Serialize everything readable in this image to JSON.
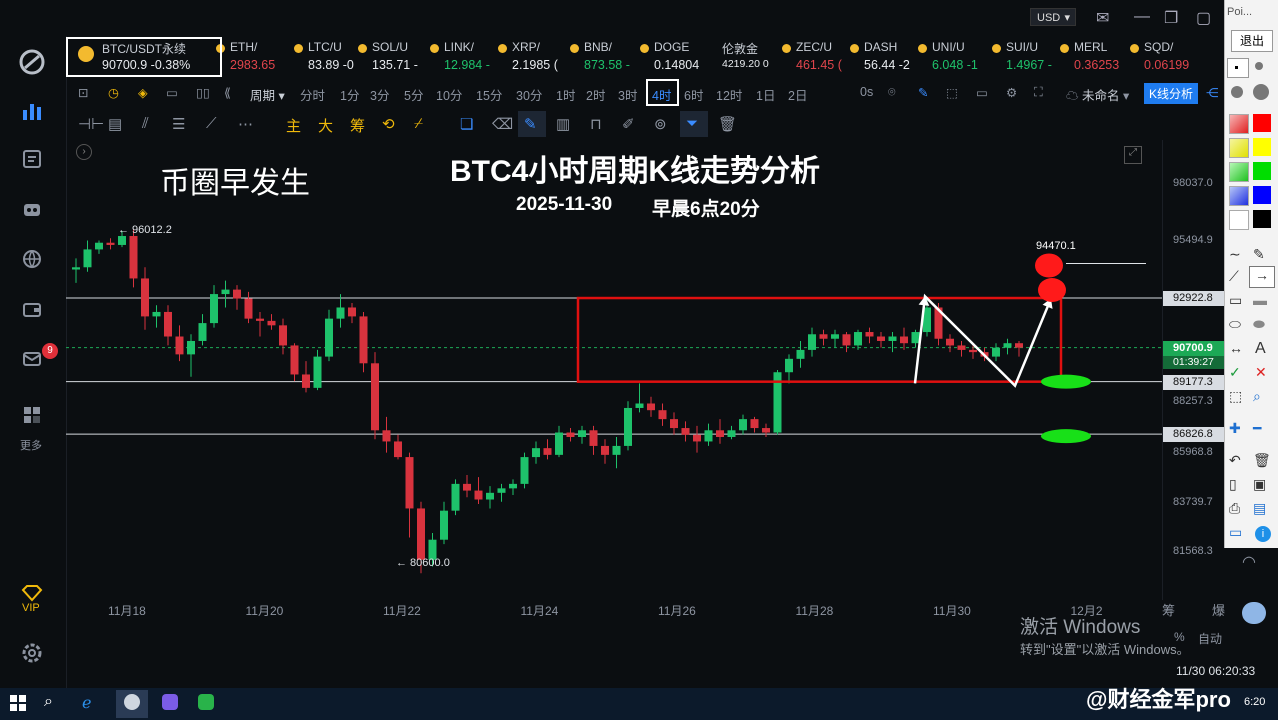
{
  "window": {
    "currency_select": "USD",
    "currency_arrow": "▾"
  },
  "sidebar": {
    "items": [
      {
        "icon": "logo-icon"
      },
      {
        "icon": "bar-chart-icon"
      },
      {
        "icon": "news-icon"
      },
      {
        "icon": "robot-icon"
      },
      {
        "icon": "globe-icon"
      },
      {
        "icon": "wallet-icon"
      },
      {
        "icon": "message-icon"
      },
      {
        "icon": "grid-icon",
        "label": "更多"
      }
    ],
    "message_badge": "9",
    "vip_label": "VIP"
  },
  "tickers": [
    {
      "name": "BTC/USDT永续",
      "price": "90700.9",
      "change": "-0.38%",
      "color": "#e8ebef"
    },
    {
      "name": "ETH/",
      "price": "2983.65",
      "change": "",
      "color": "#e0454c"
    },
    {
      "name": "LTC/U",
      "price": "83.89",
      "change": "-0",
      "color": "#e8ebef"
    },
    {
      "name": "SOL/U",
      "price": "135.71",
      "change": "-",
      "color": "#e8ebef"
    },
    {
      "name": "LINK/",
      "price": "12.984",
      "change": "-",
      "color": "#1ec26b"
    },
    {
      "name": "XRP/",
      "price": "2.1985",
      "change": "(",
      "color": "#e8ebef"
    },
    {
      "name": "BNB/",
      "price": "873.58",
      "change": "-",
      "color": "#1ec26b"
    },
    {
      "name": "DOGE",
      "price": "0.14804",
      "change": "",
      "color": "#e8ebef"
    },
    {
      "name": "伦敦金",
      "price": "4219.20",
      "change": "0",
      "color": "#e8ebef"
    },
    {
      "name": "ZEC/U",
      "price": "461.45",
      "change": "(",
      "color": "#e0454c"
    },
    {
      "name": "DASH",
      "price": "56.44",
      "change": "-2",
      "color": "#e8ebef"
    },
    {
      "name": "UNI/U",
      "price": "6.048",
      "change": "-1",
      "color": "#1ec26b"
    },
    {
      "name": "SUI/U",
      "price": "1.4967",
      "change": "-",
      "color": "#1ec26b"
    },
    {
      "name": "MERL",
      "price": "0.36253",
      "change": "",
      "color": "#e0454c"
    },
    {
      "name": "SQD/",
      "price": "0.06199",
      "change": "",
      "color": "#e0454c"
    }
  ],
  "periods": {
    "cycle_label": "周期",
    "items": [
      "分时",
      "1分",
      "3分",
      "5分",
      "10分",
      "15分",
      "30分",
      "1时",
      "2时",
      "3时",
      "4时",
      "6时",
      "12时",
      "1日",
      "2日"
    ],
    "active": "4时",
    "zero_s": "0s",
    "layout_name": "未命名",
    "kline_analysis": "K线分析"
  },
  "drawbar": {
    "main_label": "主",
    "big_label": "大",
    "chip_label": "筹"
  },
  "chart": {
    "overlay_title": "BTC4小时周期K线走势分析",
    "overlay_date": "2025-11-30",
    "overlay_time": "早晨6点20分",
    "overlay_brand": "币圈早发生",
    "high_note": "← 96012.2",
    "low_note": "← 80600.0",
    "target_note": "94470.1",
    "windows_watermark_1": "激活 Windows",
    "windows_watermark_2": "转到\"设置\"以激活 Windows。",
    "scale_chip": "筹",
    "scale_burst": "爆",
    "pct_label": "%",
    "auto_label": "自动",
    "clock": "11/30 06:20:33"
  },
  "chart_data": {
    "type": "candlestick",
    "title": "BTC4小时周期K线走势分析",
    "symbol": "BTC/USDT永续",
    "interval": "4h",
    "current_price": 90700.9,
    "countdown": "01:39:27",
    "price_ticks": [
      98037.0,
      95494.9,
      88257.3,
      85968.8,
      83739.7,
      81568.3
    ],
    "horizontal_lines": [
      92922.8,
      89177.3,
      86826.8
    ],
    "x_ticks": [
      "11月18",
      "11月20",
      "11月22",
      "11月24",
      "11月26",
      "11月28",
      "11月30",
      "12月2"
    ],
    "ylim": [
      79400,
      100000
    ],
    "high": 96012.2,
    "low": 80600.0,
    "candles": [
      {
        "o": 94200,
        "h": 94700,
        "l": 93600,
        "c": 94300
      },
      {
        "o": 94300,
        "h": 95500,
        "l": 94100,
        "c": 95100
      },
      {
        "o": 95100,
        "h": 95500,
        "l": 94900,
        "c": 95400
      },
      {
        "o": 95400,
        "h": 95600,
        "l": 95100,
        "c": 95300
      },
      {
        "o": 95300,
        "h": 95900,
        "l": 95200,
        "c": 95700
      },
      {
        "o": 95700,
        "h": 96012.2,
        "l": 93400,
        "c": 93800
      },
      {
        "o": 93800,
        "h": 94300,
        "l": 91500,
        "c": 92100
      },
      {
        "o": 92100,
        "h": 92600,
        "l": 91600,
        "c": 92300
      },
      {
        "o": 92300,
        "h": 92600,
        "l": 90800,
        "c": 91200
      },
      {
        "o": 91200,
        "h": 91700,
        "l": 90100,
        "c": 90400
      },
      {
        "o": 90400,
        "h": 91300,
        "l": 89400,
        "c": 91000
      },
      {
        "o": 91000,
        "h": 92200,
        "l": 90800,
        "c": 91800
      },
      {
        "o": 91800,
        "h": 93500,
        "l": 91600,
        "c": 93100
      },
      {
        "o": 93100,
        "h": 93700,
        "l": 92500,
        "c": 93300
      },
      {
        "o": 93300,
        "h": 93500,
        "l": 92400,
        "c": 92900
      },
      {
        "o": 92900,
        "h": 93200,
        "l": 91800,
        "c": 92000
      },
      {
        "o": 92000,
        "h": 92300,
        "l": 91200,
        "c": 91900
      },
      {
        "o": 91900,
        "h": 92200,
        "l": 91500,
        "c": 91700
      },
      {
        "o": 91700,
        "h": 92000,
        "l": 90400,
        "c": 90800
      },
      {
        "o": 90800,
        "h": 90900,
        "l": 89200,
        "c": 89500
      },
      {
        "o": 89500,
        "h": 90100,
        "l": 88700,
        "c": 88900
      },
      {
        "o": 88900,
        "h": 90600,
        "l": 88800,
        "c": 90300
      },
      {
        "o": 90300,
        "h": 92400,
        "l": 90100,
        "c": 92000
      },
      {
        "o": 92000,
        "h": 93100,
        "l": 91600,
        "c": 92500
      },
      {
        "o": 92500,
        "h": 92700,
        "l": 91800,
        "c": 92100
      },
      {
        "o": 92100,
        "h": 92300,
        "l": 89600,
        "c": 90000
      },
      {
        "o": 90000,
        "h": 90500,
        "l": 86600,
        "c": 87000
      },
      {
        "o": 87000,
        "h": 87600,
        "l": 86000,
        "c": 86500
      },
      {
        "o": 86500,
        "h": 86800,
        "l": 85700,
        "c": 85800
      },
      {
        "o": 85800,
        "h": 86000,
        "l": 82200,
        "c": 83500
      },
      {
        "o": 83500,
        "h": 83800,
        "l": 80600,
        "c": 81200
      },
      {
        "o": 81200,
        "h": 82400,
        "l": 80900,
        "c": 82100
      },
      {
        "o": 82100,
        "h": 83800,
        "l": 81900,
        "c": 83400
      },
      {
        "o": 83400,
        "h": 84800,
        "l": 83200,
        "c": 84600
      },
      {
        "o": 84600,
        "h": 85000,
        "l": 84000,
        "c": 84300
      },
      {
        "o": 84300,
        "h": 84900,
        "l": 83700,
        "c": 83900
      },
      {
        "o": 83900,
        "h": 84500,
        "l": 83500,
        "c": 84200
      },
      {
        "o": 84200,
        "h": 84600,
        "l": 83800,
        "c": 84400
      },
      {
        "o": 84400,
        "h": 84800,
        "l": 84100,
        "c": 84600
      },
      {
        "o": 84600,
        "h": 86000,
        "l": 84400,
        "c": 85800
      },
      {
        "o": 85800,
        "h": 86500,
        "l": 85500,
        "c": 86200
      },
      {
        "o": 86200,
        "h": 86600,
        "l": 85700,
        "c": 85900
      },
      {
        "o": 85900,
        "h": 87200,
        "l": 85800,
        "c": 86900
      },
      {
        "o": 86900,
        "h": 87100,
        "l": 86500,
        "c": 86700
      },
      {
        "o": 86700,
        "h": 87200,
        "l": 86400,
        "c": 87000
      },
      {
        "o": 87000,
        "h": 87200,
        "l": 85900,
        "c": 86300
      },
      {
        "o": 86300,
        "h": 86600,
        "l": 85500,
        "c": 85900
      },
      {
        "o": 85900,
        "h": 86700,
        "l": 85300,
        "c": 86300
      },
      {
        "o": 86300,
        "h": 88300,
        "l": 86100,
        "c": 88000
      },
      {
        "o": 88000,
        "h": 89100,
        "l": 87800,
        "c": 88200
      },
      {
        "o": 88200,
        "h": 88500,
        "l": 87600,
        "c": 87900
      },
      {
        "o": 87900,
        "h": 88200,
        "l": 87200,
        "c": 87500
      },
      {
        "o": 87500,
        "h": 87800,
        "l": 86800,
        "c": 87100
      },
      {
        "o": 87100,
        "h": 87400,
        "l": 86500,
        "c": 86800
      },
      {
        "o": 86800,
        "h": 87200,
        "l": 86000,
        "c": 86500
      },
      {
        "o": 86500,
        "h": 87300,
        "l": 86300,
        "c": 87000
      },
      {
        "o": 87000,
        "h": 87500,
        "l": 86400,
        "c": 86700
      },
      {
        "o": 86700,
        "h": 87200,
        "l": 86600,
        "c": 87000
      },
      {
        "o": 87000,
        "h": 87700,
        "l": 86800,
        "c": 87500
      },
      {
        "o": 87500,
        "h": 87600,
        "l": 86900,
        "c": 87100
      },
      {
        "o": 87100,
        "h": 87300,
        "l": 86700,
        "c": 86900
      },
      {
        "o": 86900,
        "h": 89700,
        "l": 86800,
        "c": 89600
      },
      {
        "o": 89600,
        "h": 90400,
        "l": 89100,
        "c": 90200
      },
      {
        "o": 90200,
        "h": 91000,
        "l": 89800,
        "c": 90600
      },
      {
        "o": 90600,
        "h": 91600,
        "l": 90300,
        "c": 91300
      },
      {
        "o": 91300,
        "h": 91500,
        "l": 90800,
        "c": 91100
      },
      {
        "o": 91100,
        "h": 91500,
        "l": 90700,
        "c": 91300
      },
      {
        "o": 91300,
        "h": 91400,
        "l": 90500,
        "c": 90800
      },
      {
        "o": 90800,
        "h": 91500,
        "l": 90600,
        "c": 91400
      },
      {
        "o": 91400,
        "h": 91600,
        "l": 90900,
        "c": 91200
      },
      {
        "o": 91200,
        "h": 91400,
        "l": 90700,
        "c": 91000
      },
      {
        "o": 91000,
        "h": 91400,
        "l": 90500,
        "c": 91200
      },
      {
        "o": 91200,
        "h": 91600,
        "l": 90600,
        "c": 90900
      },
      {
        "o": 90900,
        "h": 91500,
        "l": 90700,
        "c": 91400
      },
      {
        "o": 91400,
        "h": 92900,
        "l": 91200,
        "c": 92500
      },
      {
        "o": 92500,
        "h": 92700,
        "l": 90800,
        "c": 91100
      },
      {
        "o": 91100,
        "h": 91300,
        "l": 90500,
        "c": 90800
      },
      {
        "o": 90800,
        "h": 91000,
        "l": 90300,
        "c": 90600
      },
      {
        "o": 90600,
        "h": 90900,
        "l": 90200,
        "c": 90500
      },
      {
        "o": 90500,
        "h": 90700,
        "l": 90100,
        "c": 90300
      },
      {
        "o": 90300,
        "h": 90900,
        "l": 90100,
        "c": 90700
      },
      {
        "o": 90700,
        "h": 91100,
        "l": 90400,
        "c": 90900
      },
      {
        "o": 90900,
        "h": 91000,
        "l": 90300,
        "c": 90701
      }
    ]
  },
  "palette": {
    "header": "Poi...",
    "exit": "退出"
  },
  "taskbar": {
    "watermark": "@财经金军pro",
    "time": "6:20"
  }
}
